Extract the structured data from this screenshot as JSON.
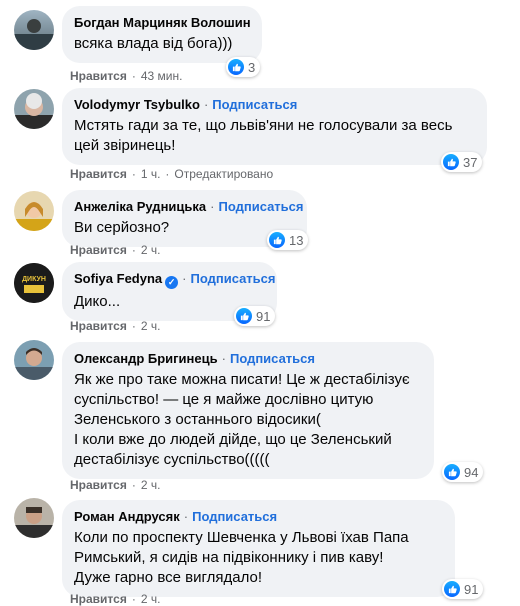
{
  "comments": [
    {
      "author": "Богдан Марциняк Волошин",
      "text": [
        "всяка влада від бога)))"
      ],
      "like_label": "Нравится",
      "time": "43 мин.",
      "edited_label": "",
      "follow_label": "",
      "reactions": "3"
    },
    {
      "author": "Volodymyr Tsybulko",
      "text": [
        "Мстять гади за те, що львів'яни не голосували за весь",
        "цей звіринець!"
      ],
      "like_label": "Нравится",
      "time": "1 ч.",
      "edited_label": "Отредактировано",
      "follow_label": "Подписаться",
      "reactions": "37"
    },
    {
      "author": "Анжеліка Рудницька",
      "text": [
        "Ви серйозно?"
      ],
      "like_label": "Нравится",
      "time": "2 ч.",
      "edited_label": "",
      "follow_label": "Подписаться",
      "reactions": "13"
    },
    {
      "author": "Sofiya Fedyna",
      "text": [
        "Дико..."
      ],
      "like_label": "Нравится",
      "time": "2 ч.",
      "edited_label": "",
      "follow_label": "Подписаться",
      "reactions": "91"
    },
    {
      "author": "Олександр Бригинець",
      "text": [
        "Як же про таке можна писати! Це ж дестабілізує",
        "суспільство! — це я майже дослівно цитую",
        "Зеленського з останнього відосики(",
        "І коли вже до людей дійде, що це Зеленський",
        "дестабілізує суспільство((((("
      ],
      "like_label": "Нравится",
      "time": "2 ч.",
      "edited_label": "",
      "follow_label": "Подписаться",
      "reactions": "94"
    },
    {
      "author": "Роман Андрусяк",
      "text": [
        "Коли по проспекту Шевченка у Львові їхав Папа",
        "Римський, я сидів на підвіконнику і пив каву!",
        "Дуже гарно все виглядало!"
      ],
      "like_label": "Нравится",
      "time": "2 ч.",
      "edited_label": "",
      "follow_label": "Подписаться",
      "reactions": "91"
    }
  ],
  "separator": "·",
  "colors": {
    "link": "#216fdb",
    "bubble": "#f0f2f5",
    "meta": "#65676b",
    "like_icon": "#0866ff"
  }
}
